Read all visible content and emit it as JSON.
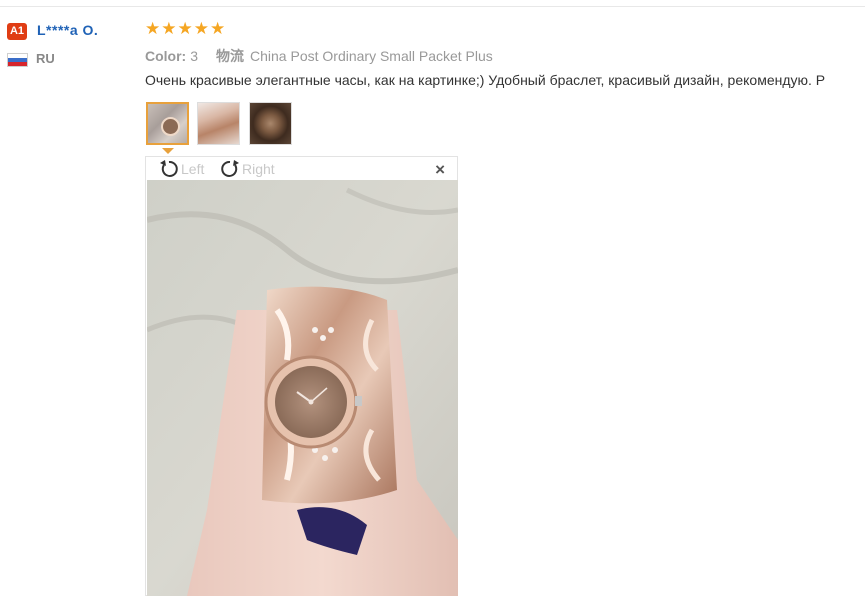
{
  "reviewer": {
    "level_badge": "A1",
    "name": "L****a O.",
    "country": "RU"
  },
  "rating": {
    "stars": 5,
    "star_glyph": "★",
    "color": "#f5a623"
  },
  "meta": {
    "color_label": "Color:",
    "color_value": "3",
    "shipping_label": "物流",
    "shipping_value": "China Post Ordinary Small Packet Plus"
  },
  "review_text": "Очень красивые элегантные часы, как на картинке;) Удобный браслет, красивый дизайн, рекомендую. Р",
  "thumbnails": [
    {
      "icon": "photo-thumbnail",
      "selected": true
    },
    {
      "icon": "photo-thumbnail",
      "selected": false
    },
    {
      "icon": "photo-thumbnail",
      "selected": false
    }
  ],
  "viewer": {
    "rotate_left_label": "Left",
    "rotate_right_label": "Right",
    "close_glyph": "×"
  },
  "colors": {
    "name_link": "#1f62b6",
    "badge": "#e03d14",
    "selected_border": "#e8a13c"
  }
}
